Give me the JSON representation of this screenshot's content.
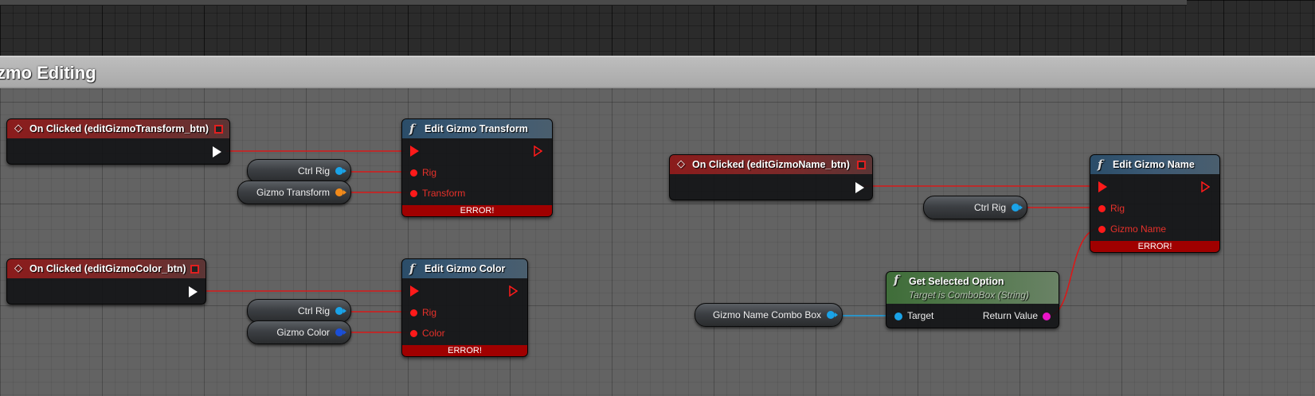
{
  "comment": {
    "title": "zmo Editing"
  },
  "colors": {
    "exec_wire": "#d81a1a",
    "object_pin": "#1aa3e8",
    "transform_pin": "#f28a1a",
    "color_pin": "#1a4fd8",
    "string_pin": "#ea14c8",
    "error_bar": "#a00000"
  },
  "icons": {
    "event": "diamond-icon",
    "function": "function-icon",
    "delegate": "delegate-pin-icon"
  },
  "events": {
    "transform": {
      "title": "On Clicked (editGizmoTransform_btn)"
    },
    "color": {
      "title": "On Clicked (editGizmoColor_btn)"
    },
    "name": {
      "title": "On Clicked (editGizmoName_btn)"
    }
  },
  "funcs": {
    "transform": {
      "title": "Edit Gizmo Transform",
      "pin_rig": "Rig",
      "pin_value": "Transform",
      "error": "ERROR!"
    },
    "color": {
      "title": "Edit Gizmo Color",
      "pin_rig": "Rig",
      "pin_value": "Color",
      "error": "ERROR!"
    },
    "name": {
      "title": "Edit Gizmo Name",
      "pin_rig": "Rig",
      "pin_value": "Gizmo Name",
      "error": "ERROR!"
    }
  },
  "pure": {
    "title": "Get Selected Option",
    "subtitle": "Target is ComboBox (String)",
    "input": "Target",
    "output": "Return Value"
  },
  "vars": {
    "ctrl_rig_1": "Ctrl Rig",
    "gizmo_transform": "Gizmo Transform",
    "ctrl_rig_2": "Ctrl Rig",
    "gizmo_color": "Gizmo Color",
    "ctrl_rig_3": "Ctrl Rig",
    "combo_box": "Gizmo Name Combo Box"
  }
}
